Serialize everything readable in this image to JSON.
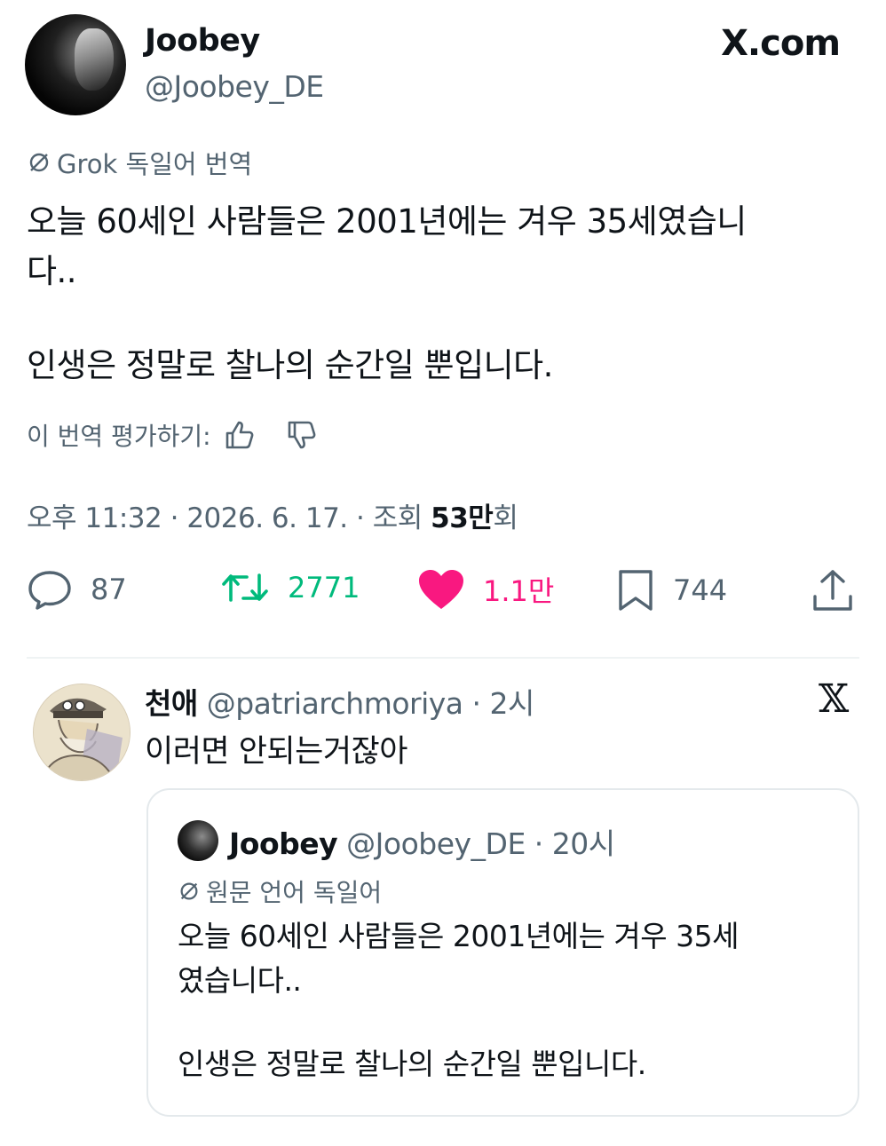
{
  "main_tweet": {
    "display_name": "Joobey",
    "handle": "@Joobey_DE",
    "site_label": "X.com",
    "translation_label": "Grok 독일어 번역",
    "body_lines": [
      "오늘 60세인 사람들은 2001년에는 겨우 35세였습니",
      "다..",
      "인생은 정말로 찰나의 순간일 뿐입니다."
    ],
    "rate_label": "이 번역 평가하기:",
    "meta": {
      "time": "오후 11:32",
      "date": "2026. 6. 17.",
      "views_label": "조회",
      "views_count": "53만",
      "views_suffix": "회"
    },
    "actions": {
      "reply_count": "87",
      "retweet_count": "2771",
      "like_count": "1.1만",
      "bookmark_count": "744"
    }
  },
  "reply_tweet": {
    "display_name": "천애",
    "handle": "@patriarchmoriya",
    "time": "2시",
    "body": "이러면 안되는거잖아"
  },
  "quoted_tweet": {
    "display_name": "Joobey",
    "handle": "@Joobey_DE",
    "time": "20시",
    "translation_label": "원문 언어 독일어",
    "body_lines": [
      "오늘 60세인 사람들은 2001년에는 겨우 35세",
      "였습니다..",
      "인생은 정말로 찰나의 순간일 뿐입니다."
    ]
  },
  "colors": {
    "text": "#0f1419",
    "secondary": "#536471",
    "retweet": "#00ba7c",
    "like": "#f91880",
    "border": "#e4e9ec"
  },
  "icons": [
    "translate-slash-icon",
    "thumbs-up-icon",
    "thumbs-down-icon",
    "reply-icon",
    "retweet-icon",
    "heart-icon",
    "bookmark-icon",
    "share-icon",
    "x-logo-icon"
  ]
}
